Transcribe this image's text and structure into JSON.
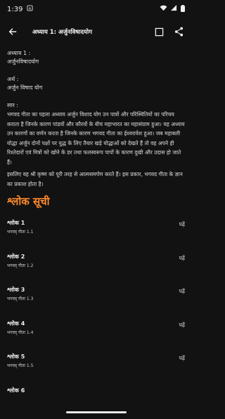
{
  "status": {
    "time": "1:39"
  },
  "appbar": {
    "title": "अध्याय 1: अर्जुनविषादयोग"
  },
  "chapter": {
    "label1": "अध्याय 1 :",
    "value1": "अर्जुनविषादयोग",
    "label2": "अर्थ :",
    "value2": "अर्जुन विषाद योग",
    "label3": "सार :",
    "para1": "भगवद गीता का पहला अध्याय अर्जुन विशाद योग उन पात्रों और परिस्थितियों का परिचय कराता है जिनके कारण पांडवों और कौरवों के बीच महाभारत का महासंग्राम हुआ। यह अध्याय उन कारणों का वर्णन करता है जिनके कारण भगवद गीता का ईश्वरावेश हुआ। जब महाबली योद्धा अर्जुन दोनों पक्षों पर युद्ध के लिए तैयार खड़े योद्धाओं को देखते हैं तो वह अपने ही रिश्तेदारों एवं मित्रों को खोने के डर तथा फलस्वरूप पापों के कारण दुखी और उदास हो जाते हैं।",
    "para2": "इसलिए वह श्री कृष्ण को पूरी तरह से आत्मसमर्पण करते हैं। इस प्रकार, भगवद गीता के ज्ञान का प्रकाश होता है।"
  },
  "shloka_section": {
    "title": "श्लोक सूची",
    "items": [
      {
        "name": "श्लोक 1",
        "sub": "भगवद् गीता 1.1",
        "action": "पढ़ें"
      },
      {
        "name": "श्लोक 2",
        "sub": "भगवद् गीता 1.2",
        "action": "पढ़ें"
      },
      {
        "name": "श्लोक 3",
        "sub": "भगवद् गीता 1.3",
        "action": "पढ़ें"
      },
      {
        "name": "श्लोक 4",
        "sub": "भगवद् गीता 1.4",
        "action": "पढ़ें"
      },
      {
        "name": "श्लोक 5",
        "sub": "भगवद् गीता 1.5",
        "action": "पढ़ें"
      },
      {
        "name": "श्लोक 6",
        "sub": "",
        "action": ""
      }
    ]
  },
  "colors": {
    "background": "#121212",
    "accent": "#ff8a2a",
    "text": "#e6e6e6"
  },
  "icons": [
    "notification-icon",
    "wifi-icon",
    "signal-icon",
    "battery-icon",
    "back-arrow-icon",
    "crop-icon",
    "share-icon"
  ]
}
